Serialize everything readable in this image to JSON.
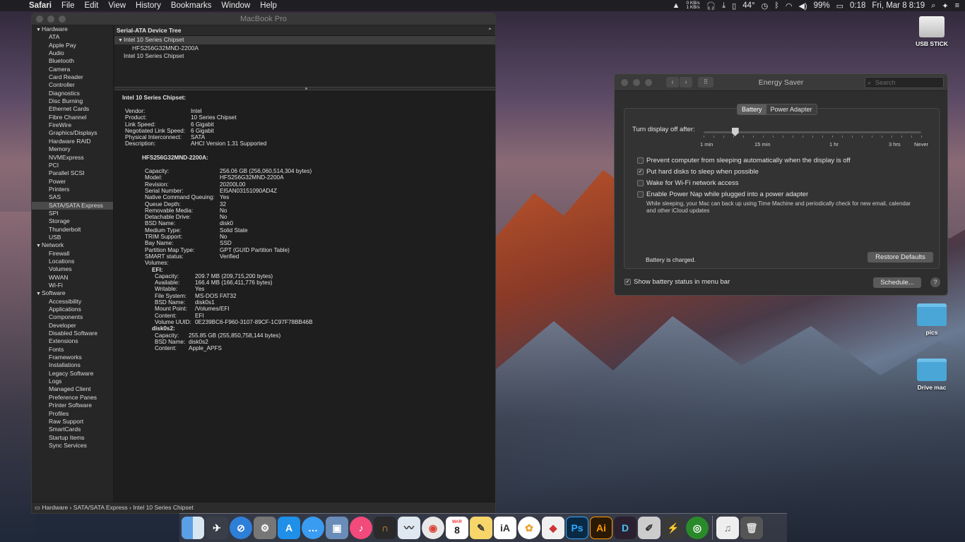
{
  "menubar": {
    "app": "Safari",
    "items": [
      "File",
      "Edit",
      "View",
      "History",
      "Bookmarks",
      "Window",
      "Help"
    ],
    "net_up": "0 KB/s",
    "net_down": "1 KB/s",
    "temp": "44°",
    "battery": "99%",
    "timer": "0:18",
    "datetime": "Fri, Mar 8  8:19"
  },
  "sysinfo": {
    "title": "MacBook Pro",
    "sidebar": [
      {
        "label": "Hardware",
        "cat": true
      },
      {
        "label": "ATA"
      },
      {
        "label": "Apple Pay"
      },
      {
        "label": "Audio"
      },
      {
        "label": "Bluetooth"
      },
      {
        "label": "Camera"
      },
      {
        "label": "Card Reader"
      },
      {
        "label": "Controller"
      },
      {
        "label": "Diagnostics"
      },
      {
        "label": "Disc Burning"
      },
      {
        "label": "Ethernet Cards"
      },
      {
        "label": "Fibre Channel"
      },
      {
        "label": "FireWire"
      },
      {
        "label": "Graphics/Displays"
      },
      {
        "label": "Hardware RAID"
      },
      {
        "label": "Memory"
      },
      {
        "label": "NVMExpress"
      },
      {
        "label": "PCI"
      },
      {
        "label": "Parallel SCSI"
      },
      {
        "label": "Power"
      },
      {
        "label": "Printers"
      },
      {
        "label": "SAS"
      },
      {
        "label": "SATA/SATA Express",
        "selected": true
      },
      {
        "label": "SPI"
      },
      {
        "label": "Storage"
      },
      {
        "label": "Thunderbolt"
      },
      {
        "label": "USB"
      },
      {
        "label": "Network",
        "cat": true
      },
      {
        "label": "Firewall"
      },
      {
        "label": "Locations"
      },
      {
        "label": "Volumes"
      },
      {
        "label": "WWAN"
      },
      {
        "label": "Wi-Fi"
      },
      {
        "label": "Software",
        "cat": true
      },
      {
        "label": "Accessibility"
      },
      {
        "label": "Applications"
      },
      {
        "label": "Components"
      },
      {
        "label": "Developer"
      },
      {
        "label": "Disabled Software"
      },
      {
        "label": "Extensions"
      },
      {
        "label": "Fonts"
      },
      {
        "label": "Frameworks"
      },
      {
        "label": "Installations"
      },
      {
        "label": "Legacy Software"
      },
      {
        "label": "Logs"
      },
      {
        "label": "Managed Client"
      },
      {
        "label": "Preference Panes"
      },
      {
        "label": "Printer Software"
      },
      {
        "label": "Profiles"
      },
      {
        "label": "Raw Support"
      },
      {
        "label": "SmartCards"
      },
      {
        "label": "Startup Items"
      },
      {
        "label": "Sync Services"
      }
    ],
    "tree_header": "Serial-ATA Device Tree",
    "tree": [
      {
        "label": "Intel 10 Series Chipset",
        "indent": 0,
        "open": true,
        "selected": true
      },
      {
        "label": "HFS256G32MND-2200A",
        "indent": 1
      },
      {
        "label": "Intel 10 Series Chipset",
        "indent": 0
      }
    ],
    "detail_heading": "Intel 10 Series Chipset:",
    "controller": [
      [
        "Vendor:",
        "Intel"
      ],
      [
        "Product:",
        "10 Series Chipset"
      ],
      [
        "Link Speed:",
        "6 Gigabit"
      ],
      [
        "Negotiated Link Speed:",
        "6 Gigabit"
      ],
      [
        "Physical Interconnect:",
        "SATA"
      ],
      [
        "Description:",
        "AHCI Version 1.31 Supported"
      ]
    ],
    "disk_heading": "HFS256G32MND-2200A:",
    "disk": [
      [
        "Capacity:",
        "256.06 GB (256,060,514,304 bytes)"
      ],
      [
        "Model:",
        "HFS256G32MND-2200A"
      ],
      [
        "Revision:",
        "20200L00"
      ],
      [
        "Serial Number:",
        "EI5AN03151090AD4Z"
      ],
      [
        "Native Command Queuing:",
        "Yes"
      ],
      [
        "Queue Depth:",
        "32"
      ],
      [
        "Removable Media:",
        "No"
      ],
      [
        "Detachable Drive:",
        "No"
      ],
      [
        "BSD Name:",
        "disk0"
      ],
      [
        "Medium Type:",
        "Solid State"
      ],
      [
        "TRIM Support:",
        "No"
      ],
      [
        "Bay Name:",
        "SSD"
      ],
      [
        "Partition Map Type:",
        "GPT (GUID Partition Table)"
      ],
      [
        "SMART status:",
        "Verified"
      ]
    ],
    "volumes_label": "Volumes:",
    "efi_label": "EFI:",
    "efi": [
      [
        "Capacity:",
        "209.7 MB (209,715,200 bytes)"
      ],
      [
        "Available:",
        "166.4 MB (166,411,776 bytes)"
      ],
      [
        "Writable:",
        "Yes"
      ],
      [
        "File System:",
        "MS-DOS FAT32"
      ],
      [
        "BSD Name:",
        "disk0s1"
      ],
      [
        "Mount Point:",
        "/Volumes/EFI"
      ],
      [
        "Content:",
        "EFI"
      ],
      [
        "Volume UUID:",
        "0E239BC6-F960-3107-89CF-1C97F78BB46B"
      ]
    ],
    "disk0s2_label": "disk0s2:",
    "disk0s2": [
      [
        "Capacity:",
        "255.85 GB (255,850,758,144 bytes)"
      ],
      [
        "BSD Name:",
        "disk0s2"
      ],
      [
        "Content:",
        "Apple_APFS"
      ]
    ],
    "breadcrumb": "Hardware › SATA/SATA Express › Intel 10 Series Chipset"
  },
  "energy": {
    "title": "Energy Saver",
    "search_placeholder": "Search",
    "tabs": [
      "Battery",
      "Power Adapter"
    ],
    "slider_label": "Turn display off after:",
    "slider_value_fraction": 0.145,
    "ticks": [
      "1 min",
      "15 min",
      "1 hr",
      "3 hrs",
      "Never"
    ],
    "checkboxes": [
      {
        "label": "Prevent computer from sleeping automatically when the display is off",
        "checked": false
      },
      {
        "label": "Put hard disks to sleep when possible",
        "checked": true
      },
      {
        "label": "Wake for Wi-Fi network access",
        "checked": false
      },
      {
        "label": "Enable Power Nap while plugged into a power adapter",
        "checked": false
      }
    ],
    "powernap_desc": "While sleeping, your Mac can back up using Time Machine and periodically check for new email, calendar and other iCloud updates",
    "status": "Battery is charged.",
    "restore": "Restore Defaults",
    "show_battery": "Show battery status in menu bar",
    "show_battery_checked": true,
    "schedule": "Schedule...",
    "help": "?"
  },
  "desktop": {
    "usb": "USB STICK",
    "pics": "pics",
    "drive_mac": "Drive mac"
  },
  "dock": {
    "calendar_month": "MAR",
    "calendar_day": "8",
    "ps": "Ps",
    "ai": "Ai"
  }
}
